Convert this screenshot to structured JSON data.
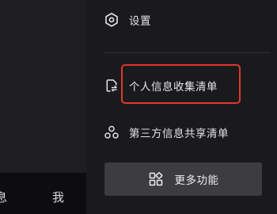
{
  "bottom_nav": {
    "tab_partial_label": "息",
    "tab_me_label": "我"
  },
  "drawer": {
    "settings_label": "设置",
    "personal_info_label": "个人信息收集清单",
    "third_party_label": "第三方信息共享清单",
    "more_features_label": "更多功能"
  },
  "icons": {
    "settings": "gear-icon",
    "personal_info": "document-sync-icon",
    "third_party": "share-nodes-icon",
    "more_features": "grid-apps-icon"
  },
  "colors": {
    "highlight": "#e0382c",
    "drawer_bg": "#1a1a1d",
    "button_bg": "#3c3c41"
  }
}
